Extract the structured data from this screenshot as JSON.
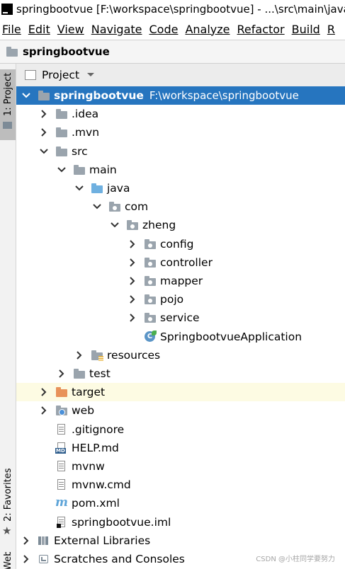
{
  "window": {
    "title": "springbootvue [F:\\workspace\\springbootvue] - ...\\src\\main\\java\\"
  },
  "menu": [
    "File",
    "Edit",
    "View",
    "Navigate",
    "Code",
    "Analyze",
    "Refactor",
    "Build",
    "R"
  ],
  "menu_mnemonic_index": [
    0,
    0,
    0,
    0,
    0,
    0,
    0,
    0,
    0
  ],
  "navbar": {
    "project": "springbootvue"
  },
  "sidebar": {
    "project_tab": "1: Project",
    "favorites_tab": "2: Favorites",
    "web_tab": "Web"
  },
  "panel": {
    "title": "Project"
  },
  "tree": [
    {
      "label": "springbootvue",
      "path": "F:\\workspace\\springbootvue",
      "depth": 0,
      "expand": "open",
      "icon": "module-folder-icon",
      "selected": true
    },
    {
      "label": ".idea",
      "depth": 1,
      "expand": "closed",
      "icon": "folder-icon"
    },
    {
      "label": ".mvn",
      "depth": 1,
      "expand": "closed",
      "icon": "folder-icon"
    },
    {
      "label": "src",
      "depth": 1,
      "expand": "open",
      "icon": "folder-icon"
    },
    {
      "label": "main",
      "depth": 2,
      "expand": "open",
      "icon": "folder-icon"
    },
    {
      "label": "java",
      "depth": 3,
      "expand": "open",
      "icon": "source-folder-icon"
    },
    {
      "label": "com",
      "depth": 4,
      "expand": "open",
      "icon": "package-icon"
    },
    {
      "label": "zheng",
      "depth": 5,
      "expand": "open",
      "icon": "package-icon"
    },
    {
      "label": "config",
      "depth": 6,
      "expand": "closed",
      "icon": "package-icon"
    },
    {
      "label": "controller",
      "depth": 6,
      "expand": "closed",
      "icon": "package-icon"
    },
    {
      "label": "mapper",
      "depth": 6,
      "expand": "closed",
      "icon": "package-icon"
    },
    {
      "label": "pojo",
      "depth": 6,
      "expand": "closed",
      "icon": "package-icon"
    },
    {
      "label": "service",
      "depth": 6,
      "expand": "closed",
      "icon": "package-icon"
    },
    {
      "label": "SpringbootvueApplication",
      "depth": 6,
      "expand": "none",
      "icon": "spring-boot-class-icon"
    },
    {
      "label": "resources",
      "depth": 3,
      "expand": "closed",
      "icon": "resources-folder-icon"
    },
    {
      "label": "test",
      "depth": 2,
      "expand": "closed",
      "icon": "folder-icon"
    },
    {
      "label": "target",
      "depth": 1,
      "expand": "closed",
      "icon": "excluded-folder-icon",
      "excluded": true
    },
    {
      "label": "web",
      "depth": 1,
      "expand": "closed",
      "icon": "web-folder-icon"
    },
    {
      "label": ".gitignore",
      "depth": 1,
      "expand": "none",
      "icon": "text-file-icon"
    },
    {
      "label": "HELP.md",
      "depth": 1,
      "expand": "none",
      "icon": "markdown-file-icon"
    },
    {
      "label": "mvnw",
      "depth": 1,
      "expand": "none",
      "icon": "text-file-icon"
    },
    {
      "label": "mvnw.cmd",
      "depth": 1,
      "expand": "none",
      "icon": "text-file-icon"
    },
    {
      "label": "pom.xml",
      "depth": 1,
      "expand": "none",
      "icon": "maven-file-icon"
    },
    {
      "label": "springbootvue.iml",
      "depth": 1,
      "expand": "none",
      "icon": "iml-file-icon"
    },
    {
      "label": "External Libraries",
      "depth": 0,
      "expand": "closed",
      "icon": "libraries-icon"
    },
    {
      "label": "Scratches and Consoles",
      "depth": 0,
      "expand": "closed",
      "icon": "scratches-icon"
    }
  ],
  "watermark": "CSDN @小柱同学要努力",
  "colors": {
    "selection": "#2675bf",
    "excluded_bg": "#fdfbe3",
    "source_folder": "#6fb0e0",
    "excluded_folder": "#e8925a"
  }
}
